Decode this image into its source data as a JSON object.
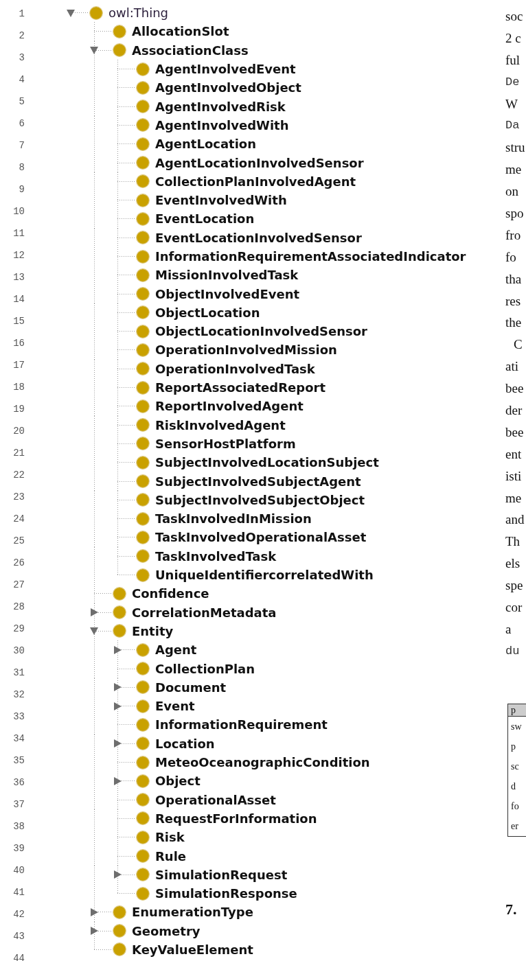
{
  "line_numbers": [
    "1",
    "2",
    "3",
    "4",
    "5",
    "6",
    "7",
    "8",
    "9",
    "10",
    "11",
    "12",
    "13",
    "14",
    "15",
    "16",
    "17",
    "18",
    "19",
    "20",
    "21",
    "22",
    "23",
    "24",
    "25",
    "26",
    "27",
    "28",
    "29",
    "30",
    "31",
    "32",
    "33",
    "34",
    "35",
    "36",
    "37",
    "38",
    "39",
    "40",
    "41",
    "42",
    "43",
    "44"
  ],
  "tree": {
    "label": "owl:Thing",
    "expanded": true,
    "children": [
      {
        "label": "AllocationSlot"
      },
      {
        "label": "AssociationClass",
        "expanded": true,
        "children": [
          {
            "label": "AgentInvolvedEvent"
          },
          {
            "label": "AgentInvolvedObject"
          },
          {
            "label": "AgentInvolvedRisk"
          },
          {
            "label": "AgentInvolvedWith"
          },
          {
            "label": "AgentLocation"
          },
          {
            "label": "AgentLocationInvolvedSensor"
          },
          {
            "label": "CollectionPlanInvolvedAgent"
          },
          {
            "label": "EventInvolvedWith"
          },
          {
            "label": "EventLocation"
          },
          {
            "label": "EventLocationInvolvedSensor"
          },
          {
            "label": "InformationRequirementAssociatedIndicator"
          },
          {
            "label": "MissionInvolvedTask"
          },
          {
            "label": "ObjectInvolvedEvent"
          },
          {
            "label": "ObjectLocation"
          },
          {
            "label": "ObjectLocationInvolvedSensor"
          },
          {
            "label": "OperationInvolvedMission"
          },
          {
            "label": "OperationInvolvedTask"
          },
          {
            "label": "ReportAssociatedReport"
          },
          {
            "label": "ReportInvolvedAgent"
          },
          {
            "label": "RiskInvolvedAgent"
          },
          {
            "label": "SensorHostPlatform"
          },
          {
            "label": "SubjectInvolvedLocationSubject"
          },
          {
            "label": "SubjectInvolvedSubjectAgent"
          },
          {
            "label": "SubjectInvolvedSubjectObject"
          },
          {
            "label": "TaskInvolvedInMission"
          },
          {
            "label": "TaskInvolvedOperationalAsset"
          },
          {
            "label": "TaskInvolvedTask"
          },
          {
            "label": "UniqueIdentifiercorrelatedWith"
          }
        ]
      },
      {
        "label": "Confidence"
      },
      {
        "label": "CorrelationMetadata",
        "expanded": false
      },
      {
        "label": "Entity",
        "expanded": true,
        "children": [
          {
            "label": "Agent",
            "expanded": false
          },
          {
            "label": "CollectionPlan"
          },
          {
            "label": "Document",
            "expanded": false
          },
          {
            "label": "Event",
            "expanded": false
          },
          {
            "label": "InformationRequirement"
          },
          {
            "label": "Location",
            "expanded": false
          },
          {
            "label": "MeteoOceanographicCondition"
          },
          {
            "label": "Object",
            "expanded": false
          },
          {
            "label": "OperationalAsset"
          },
          {
            "label": "RequestForInformation"
          },
          {
            "label": "Risk"
          },
          {
            "label": "Rule"
          },
          {
            "label": "SimulationRequest",
            "expanded": false
          },
          {
            "label": "SimulationResponse"
          }
        ]
      },
      {
        "label": "EnumerationType",
        "expanded": false
      },
      {
        "label": "Geometry",
        "expanded": false
      },
      {
        "label": "KeyValueElement"
      }
    ]
  },
  "side_text": [
    {
      "text": "soc",
      "kind": "prose"
    },
    {
      "text": "2 c",
      "kind": "prose"
    },
    {
      "text": "ful",
      "kind": "prose"
    },
    {
      "text": "De",
      "kind": "code"
    },
    {
      "text": "W",
      "kind": "prose"
    },
    {
      "text": "Da",
      "kind": "code"
    },
    {
      "text": "stru",
      "kind": "prose"
    },
    {
      "text": "me",
      "kind": "prose"
    },
    {
      "text": "on",
      "kind": "prose"
    },
    {
      "text": "spo",
      "kind": "prose"
    },
    {
      "text": "fro",
      "kind": "prose"
    },
    {
      "text": "fo",
      "kind": "prose"
    },
    {
      "text": "tha",
      "kind": "prose"
    },
    {
      "text": "res",
      "kind": "prose"
    },
    {
      "text": "the",
      "kind": "prose"
    },
    {
      "text": "C",
      "kind": "indent"
    },
    {
      "text": "ati",
      "kind": "prose"
    },
    {
      "text": "bee",
      "kind": "prose"
    },
    {
      "text": "der",
      "kind": "prose"
    },
    {
      "text": "bee",
      "kind": "prose"
    },
    {
      "text": "ent",
      "kind": "prose"
    },
    {
      "text": "isti",
      "kind": "prose"
    },
    {
      "text": "me",
      "kind": "prose"
    },
    {
      "text": "and",
      "kind": "prose"
    },
    {
      "text": "Th",
      "kind": "prose"
    },
    {
      "text": "els",
      "kind": "prose"
    },
    {
      "text": "spe",
      "kind": "prose"
    },
    {
      "text": "cor",
      "kind": "prose"
    },
    {
      "text": "a",
      "kind": "prose"
    },
    {
      "text": "du",
      "kind": "code"
    }
  ],
  "table": {
    "header": "p",
    "rows": [
      "sw",
      "p",
      "sc",
      "d",
      "fo",
      "er"
    ]
  },
  "heading": "7."
}
